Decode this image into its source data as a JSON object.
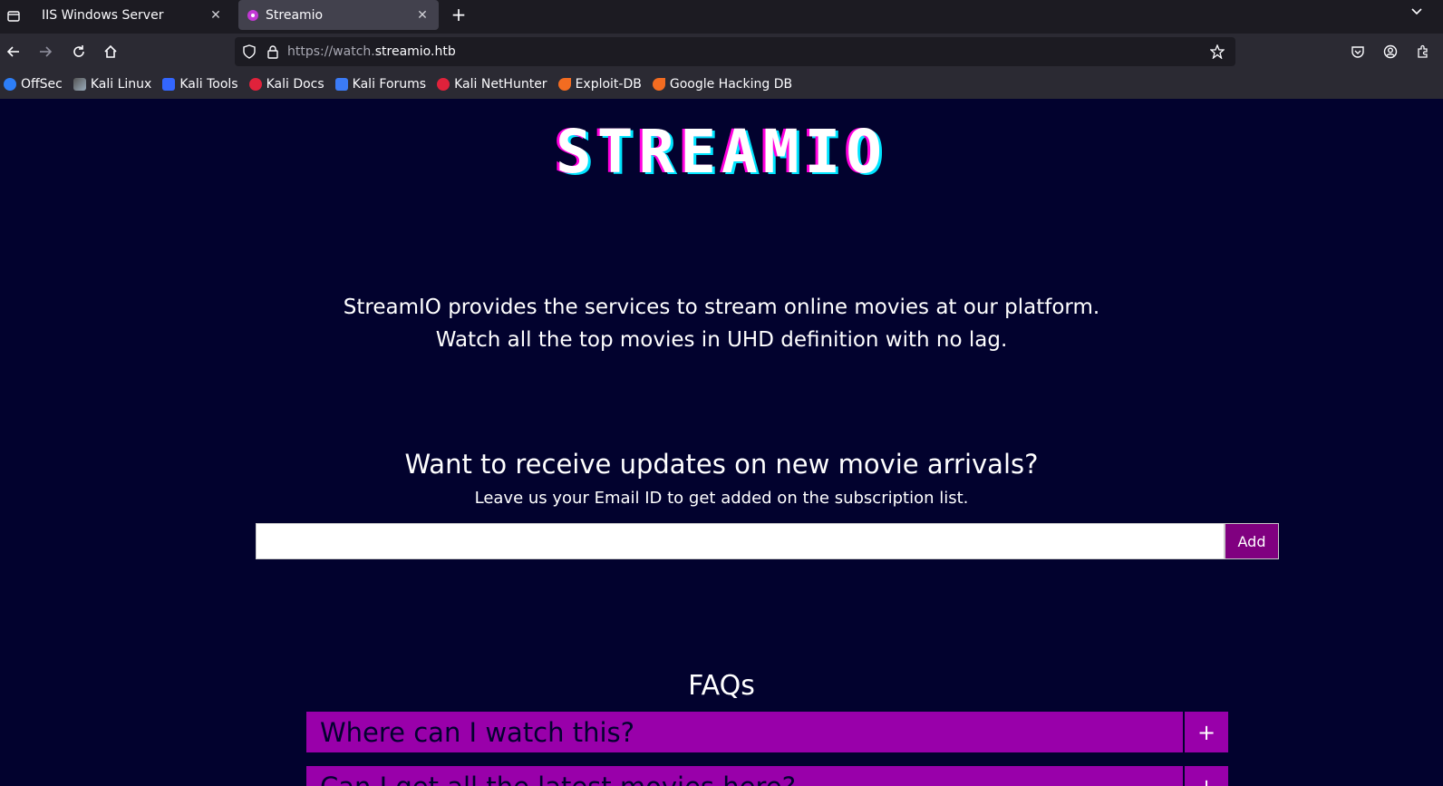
{
  "browser": {
    "tabs": [
      {
        "label": "IIS Windows Server",
        "active": false
      },
      {
        "label": "Streamio",
        "active": true
      }
    ],
    "url": {
      "scheme_prefix": "https://watch.",
      "host": "streamio.htb"
    },
    "bookmarks": [
      {
        "label": "OffSec",
        "icon": "offsec-icon",
        "color": "#2d7ef7"
      },
      {
        "label": "Kali Linux",
        "icon": "kali-dragon-icon",
        "color": "#9ab"
      },
      {
        "label": "Kali Tools",
        "icon": "kali-tools-icon",
        "color": "#3366ff"
      },
      {
        "label": "Kali Docs",
        "icon": "kali-docs-icon",
        "color": "#e0223b"
      },
      {
        "label": "Kali Forums",
        "icon": "kali-forums-icon",
        "color": "#3b7bf7"
      },
      {
        "label": "Kali NetHunter",
        "icon": "kali-nethunter-icon",
        "color": "#e0223b"
      },
      {
        "label": "Exploit-DB",
        "icon": "exploit-db-icon",
        "color": "#f36c21"
      },
      {
        "label": "Google Hacking DB",
        "icon": "ghdb-icon",
        "color": "#f36c21"
      }
    ]
  },
  "page": {
    "logo": "STREAMIO",
    "intro_line1": "StreamIO provides the services to stream online movies at our platform.",
    "intro_line2": "Watch all the top movies in UHD definition with no lag.",
    "subscribe_heading": "Want to receive updates on new movie arrivals?",
    "subscribe_note": "Leave us your Email ID to get added on the subscription list.",
    "email_value": "",
    "add_label": "Add",
    "faq_title": "FAQs",
    "faqs": [
      {
        "question": "Where can I watch this?",
        "toggle": "+"
      },
      {
        "question": "Can I get all the latest movies here?",
        "toggle": "+"
      }
    ]
  },
  "colors": {
    "page_bg": "#02022e",
    "accent": "#9900aa",
    "button": "#800080"
  }
}
